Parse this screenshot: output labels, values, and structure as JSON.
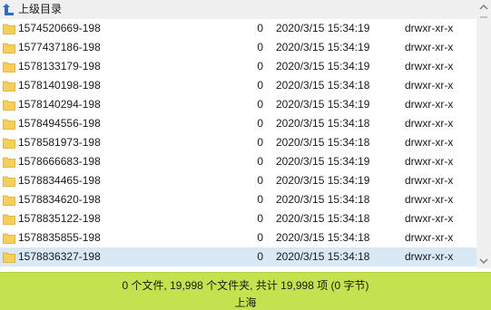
{
  "parent_row": {
    "label": "上级目录"
  },
  "rows": [
    {
      "name": "1574520669-198",
      "size": "0",
      "modified": "2020/3/15 15:34:19",
      "perms": "drwxr-xr-x"
    },
    {
      "name": "1577437186-198",
      "size": "0",
      "modified": "2020/3/15 15:34:19",
      "perms": "drwxr-xr-x"
    },
    {
      "name": "1578133179-198",
      "size": "0",
      "modified": "2020/3/15 15:34:19",
      "perms": "drwxr-xr-x"
    },
    {
      "name": "1578140198-198",
      "size": "0",
      "modified": "2020/3/15 15:34:18",
      "perms": "drwxr-xr-x"
    },
    {
      "name": "1578140294-198",
      "size": "0",
      "modified": "2020/3/15 15:34:19",
      "perms": "drwxr-xr-x"
    },
    {
      "name": "1578494556-198",
      "size": "0",
      "modified": "2020/3/15 15:34:18",
      "perms": "drwxr-xr-x"
    },
    {
      "name": "1578581973-198",
      "size": "0",
      "modified": "2020/3/15 15:34:18",
      "perms": "drwxr-xr-x"
    },
    {
      "name": "1578666683-198",
      "size": "0",
      "modified": "2020/3/15 15:34:19",
      "perms": "drwxr-xr-x"
    },
    {
      "name": "1578834465-198",
      "size": "0",
      "modified": "2020/3/15 15:34:19",
      "perms": "drwxr-xr-x"
    },
    {
      "name": "1578834620-198",
      "size": "0",
      "modified": "2020/3/15 15:34:18",
      "perms": "drwxr-xr-x"
    },
    {
      "name": "1578835122-198",
      "size": "0",
      "modified": "2020/3/15 15:34:18",
      "perms": "drwxr-xr-x"
    },
    {
      "name": "1578835855-198",
      "size": "0",
      "modified": "2020/3/15 15:34:18",
      "perms": "drwxr-xr-x"
    },
    {
      "name": "1578836327-198",
      "size": "0",
      "modified": "2020/3/15 15:34:18",
      "perms": "drwxr-xr-x",
      "selected": true
    }
  ],
  "status_bar": {
    "summary": "0 个文件, 19,998 个文件夹, 共计 19,998 项 (0 字节)",
    "location": "上海"
  },
  "colors": {
    "status_bar_bg": "#c4e24f",
    "selected_row_bg": "#d9e8f5",
    "folder_icon": "#f5cf5c",
    "up_arrow": "#2f6fc0"
  },
  "icons": {
    "parent": "parent-directory-icon",
    "folder": "folder-icon"
  }
}
